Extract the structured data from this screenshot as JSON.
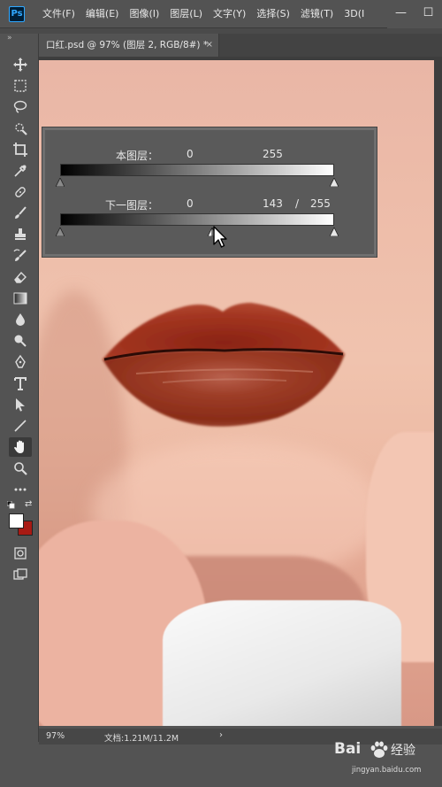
{
  "menu": {
    "logo": "Ps",
    "items": [
      "文件(F)",
      "编辑(E)",
      "图像(I)",
      "图层(L)",
      "文字(Y)",
      "选择(S)",
      "滤镜(T)",
      "3D(I"
    ]
  },
  "window_controls": {
    "minimize": "—",
    "maximize": "☐"
  },
  "toolbar": {
    "collapse_glyph": "»",
    "tools": [
      "move-icon",
      "marquee-icon",
      "lasso-icon",
      "quick-select-icon",
      "crop-icon",
      "eyedropper-icon",
      "healing-icon",
      "brush-icon",
      "stamp-icon",
      "history-brush-icon",
      "eraser-icon",
      "gradient-icon",
      "blur-icon",
      "dodge-icon",
      "pen-icon",
      "type-icon",
      "path-select-icon",
      "line-icon",
      "hand-icon",
      "zoom-icon",
      "more-icon",
      "quick-mask-icon",
      "screen-mode-icon"
    ],
    "foreground_color": "#ffffff",
    "background_color": "#a81a14"
  },
  "document": {
    "tab_title": "口红.psd @ 97% (图层 2, RGB/8#) *",
    "tab_close": "×"
  },
  "blend_if": {
    "this_layer": {
      "label": "本图层：",
      "min": "0",
      "max": "255"
    },
    "underlying_layer": {
      "label": "下一图层：",
      "min": "0",
      "split_low": "143",
      "separator": "/",
      "max": "255"
    }
  },
  "status": {
    "zoom": "97%",
    "doc_info": "文档:1.21M/11.2M",
    "arrow": "›"
  },
  "watermark": {
    "brand": "Bai",
    "brand_suffix": "经验",
    "url": "jingyan.baidu.com"
  }
}
